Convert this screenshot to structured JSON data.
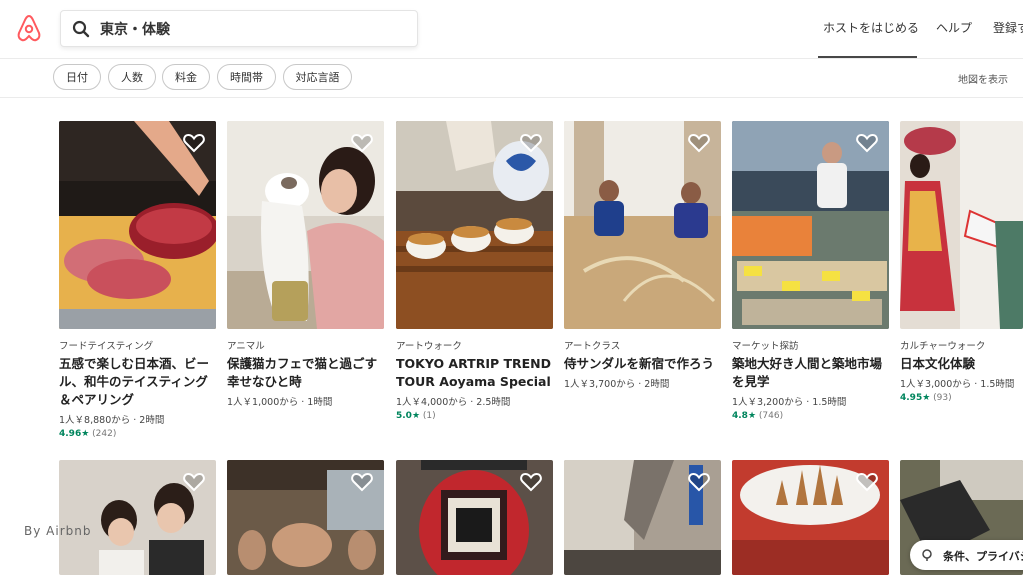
{
  "header": {
    "search_value": "東京・体験",
    "nav": [
      "ホストをはじめる",
      "ヘルプ",
      "登録す"
    ]
  },
  "filters": {
    "pills": [
      "日付",
      "人数",
      "料金",
      "時間帯",
      "対応言語"
    ],
    "map_link": "地図を表示"
  },
  "cards": [
    {
      "category": "フードテイスティング",
      "title": "五感で楽しむ日本酒、ビール、和牛のテイスティング＆ペアリング",
      "meta": "1人￥8,880から · 2時間",
      "score": "4.96★",
      "count": "(242)"
    },
    {
      "category": "アニマル",
      "title": "保護猫カフェで猫と過ごす幸せなひと時",
      "meta": "1人￥1,000から · 1時間",
      "score": "",
      "count": ""
    },
    {
      "category": "アートウォーク",
      "title": "TOKYO ARTRIP TREND TOUR Aoyama Special",
      "meta": "1人￥4,000から · 2.5時間",
      "score": "5.0★",
      "count": "(1)"
    },
    {
      "category": "アートクラス",
      "title": "侍サンダルを新宿で作ろう",
      "meta": "1人￥3,700から · 2時間",
      "score": "",
      "count": ""
    },
    {
      "category": "マーケット探訪",
      "title": "築地大好き人間と築地市場を見学",
      "meta": "1人￥3,200から · 1.5時間",
      "score": "4.8★",
      "count": "(746)"
    },
    {
      "category": "カルチャーウォーク",
      "title": "日本文化体験",
      "meta": "1人￥3,000から · 1.5時間",
      "score": "4.95★",
      "count": "(93)"
    }
  ],
  "watermark": "By Airbnb",
  "privacy_label": "条件、プライバシ",
  "colors": {
    "brand": "#ff5a5f",
    "rating": "#00855d"
  }
}
